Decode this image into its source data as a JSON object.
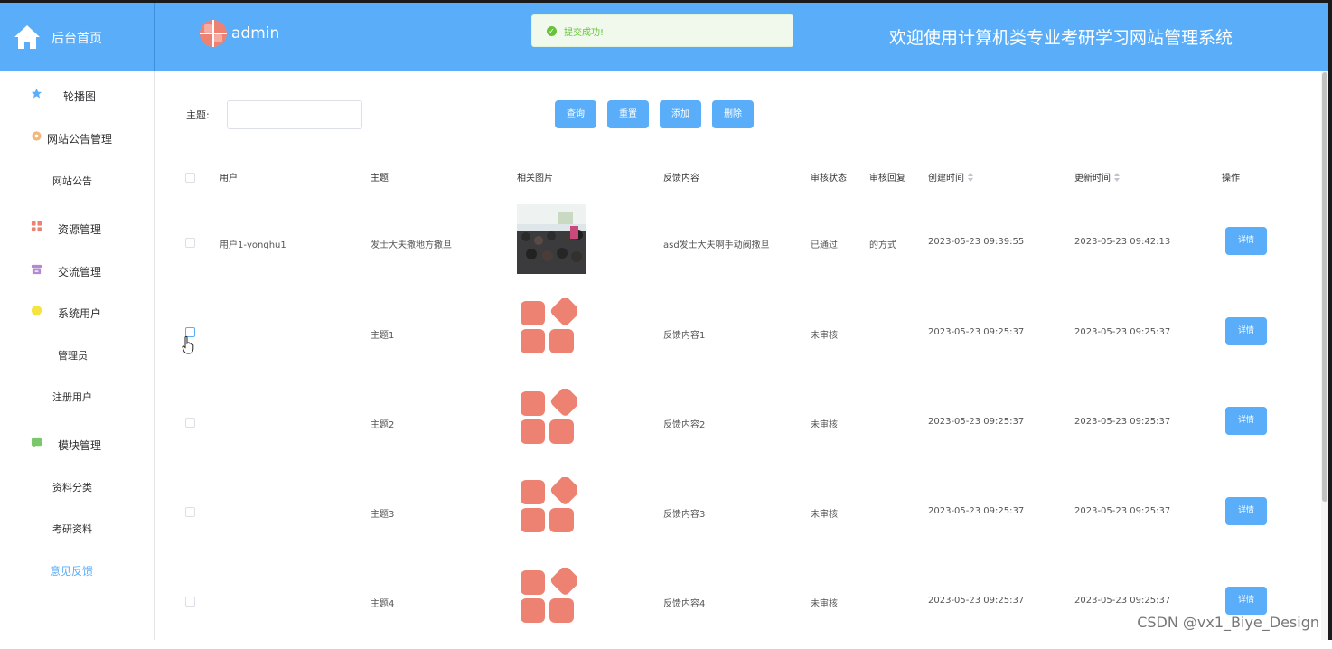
{
  "sidebar_head": {
    "home_label": "后台首页"
  },
  "header": {
    "username": "admin",
    "site_title": "欢迎使用计算机类专业考研学习网站管理系统"
  },
  "toast": {
    "message": "提交成功!"
  },
  "menu": [
    {
      "label": "轮播图",
      "icon": "star-icon"
    },
    {
      "label": "网站公告管理",
      "icon": "gear-icon"
    },
    {
      "label": "网站公告",
      "icon": ""
    },
    {
      "label": "资源管理",
      "icon": "grid-icon"
    },
    {
      "label": "交流管理",
      "icon": "archive-icon"
    },
    {
      "label": "系统用户",
      "icon": "user-circle-icon"
    },
    {
      "label": "管理员",
      "icon": ""
    },
    {
      "label": "注册用户",
      "icon": ""
    },
    {
      "label": "模块管理",
      "icon": "chat-icon"
    },
    {
      "label": "资料分类",
      "icon": ""
    },
    {
      "label": "考研资料",
      "icon": ""
    },
    {
      "label": "意见反馈",
      "icon": ""
    }
  ],
  "search": {
    "label": "主题:",
    "value": ""
  },
  "buttons": {
    "query": "查询",
    "reset": "重置",
    "add": "添加",
    "delete": "删除"
  },
  "table": {
    "headers": [
      "用户",
      "主题",
      "相关图片",
      "反馈内容",
      "审核状态",
      "审核回复",
      "创建时间",
      "更新时间",
      "操作"
    ],
    "rows": [
      {
        "user": "用户1-yonghu1",
        "subject": "发士大夫撒地方撒旦",
        "image": "photo",
        "content": "asd发士大夫啊手动阀撒旦",
        "status": "已通过",
        "reply": "的方式",
        "created": "2023-05-23 09:39:55",
        "updated": "2023-05-23 09:42:13",
        "action": "详情"
      },
      {
        "user": "",
        "subject": "主题1",
        "image": "logo",
        "content": "反馈内容1",
        "status": "未审核",
        "reply": "",
        "created": "2023-05-23 09:25:37",
        "updated": "2023-05-23 09:25:37",
        "action": "详情"
      },
      {
        "user": "",
        "subject": "主题2",
        "image": "logo",
        "content": "反馈内容2",
        "status": "未审核",
        "reply": "",
        "created": "2023-05-23 09:25:37",
        "updated": "2023-05-23 09:25:37",
        "action": "详情"
      },
      {
        "user": "",
        "subject": "主题3",
        "image": "logo",
        "content": "反馈内容3",
        "status": "未审核",
        "reply": "",
        "created": "2023-05-23 09:25:37",
        "updated": "2023-05-23 09:25:37",
        "action": "详情"
      },
      {
        "user": "",
        "subject": "主题4",
        "image": "logo",
        "content": "反馈内容4",
        "status": "未审核",
        "reply": "",
        "created": "2023-05-23 09:25:37",
        "updated": "2023-05-23 09:25:37",
        "action": "详情"
      }
    ]
  },
  "watermark": "CSDN @vx1_Biye_Design",
  "colors": {
    "primary": "#5aaef9",
    "active_menu": "#5aaef9",
    "success": "#67c23a",
    "logo": "#ed8273"
  }
}
